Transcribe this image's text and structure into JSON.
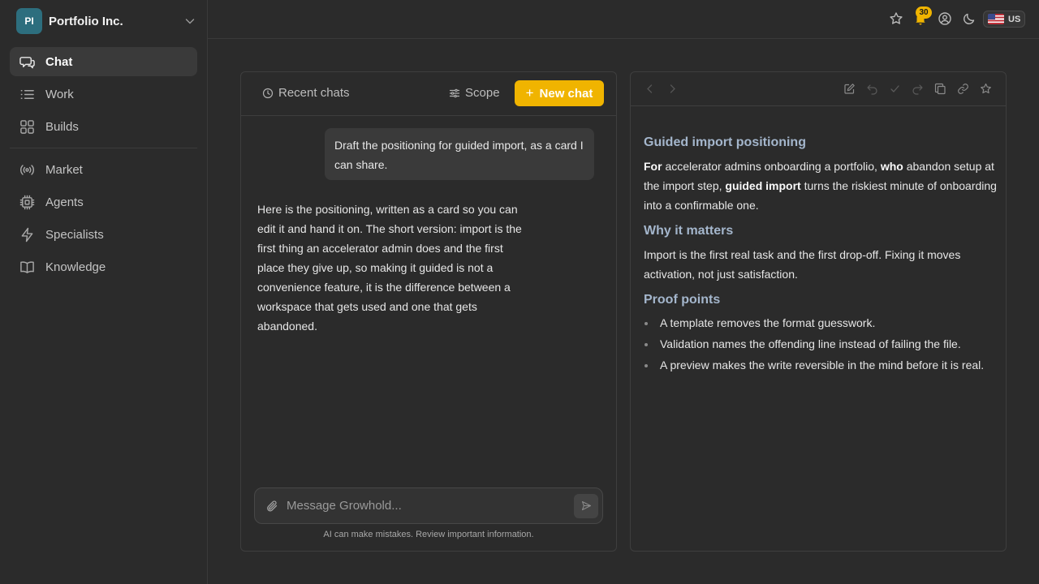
{
  "org": {
    "initials": "PI",
    "name": "Portfolio Inc."
  },
  "sidebar": {
    "items": [
      {
        "label": "Chat",
        "icon": "chat-icon",
        "active": true
      },
      {
        "label": "Work",
        "icon": "list-icon"
      },
      {
        "label": "Builds",
        "icon": "grid-icon"
      },
      {
        "label": "Market",
        "icon": "broadcast-icon"
      },
      {
        "label": "Agents",
        "icon": "chip-icon"
      },
      {
        "label": "Specialists",
        "icon": "bolt-icon"
      },
      {
        "label": "Knowledge",
        "icon": "book-icon"
      }
    ]
  },
  "topbar": {
    "notification_count": "30",
    "locale": "US"
  },
  "chat": {
    "recent_label": "Recent chats",
    "scope_label": "Scope",
    "new_chat_label": "New chat",
    "user_message": "Draft the positioning for guided import, as a card I can share.",
    "assistant_message": "Here is the positioning, written as a card so you can edit it and hand it on. The short version: import is the first thing an accelerator admin does and the first place they give up, so making it guided is not a convenience feature, it is the difference between a workspace that gets used and one that gets abandoned.",
    "input_placeholder": "Message Growhold...",
    "disclaimer": "AI can make mistakes. Review important information."
  },
  "document": {
    "title": "Guided import positioning",
    "intro": {
      "w1": "For",
      "t1": " accelerator admins onboarding a portfolio, ",
      "w2": "who",
      "t2": " abandon setup at the import step, ",
      "w3": "guided import",
      "t3": " turns the riskiest minute of onboarding into a confirmable one."
    },
    "section2_title": "Why it matters",
    "section2_body": "Import is the first real task and the first drop-off. Fixing it moves activation, not just satisfaction.",
    "section3_title": "Proof points",
    "bullets": [
      "A template removes the format guesswork.",
      "Validation names the offending line instead of failing the file.",
      "A preview makes the write reversible in the mind before it is real."
    ]
  },
  "colors": {
    "accent": "#f0b400",
    "heading": "#a4b6cc",
    "org_avatar": "#2d6e7e",
    "background": "#2b2b2b"
  }
}
